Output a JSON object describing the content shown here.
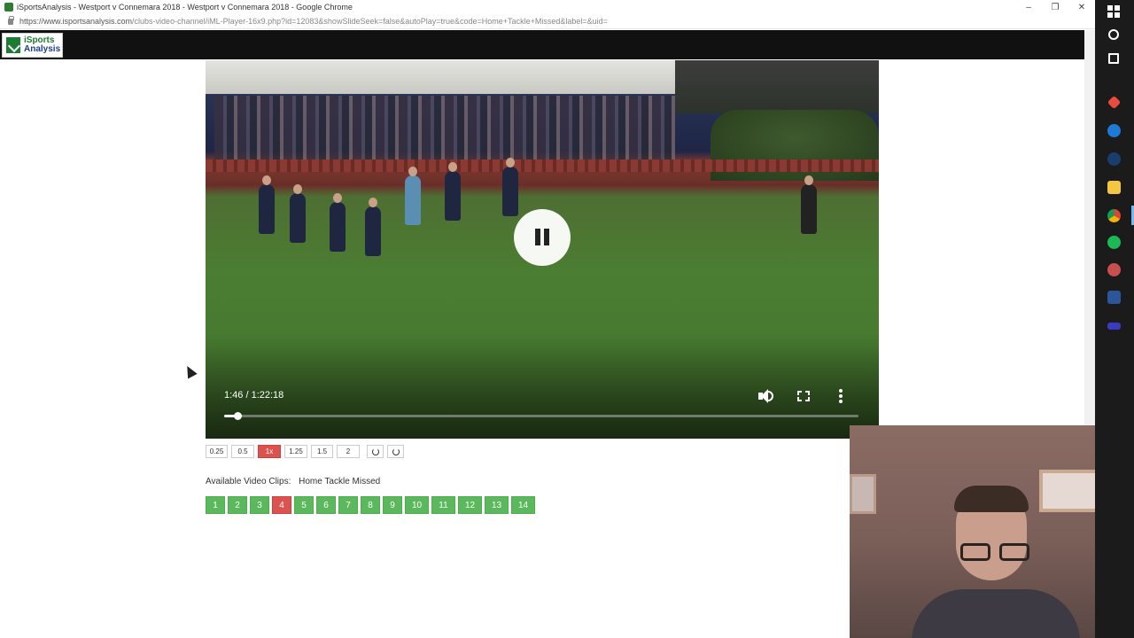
{
  "window": {
    "title": "iSportsAnalysis - Westport v Connemara 2018 - Westport v Connemara 2018 - Google Chrome",
    "minimize": "–",
    "restore": "❐",
    "close": "✕"
  },
  "address": {
    "url_host": "https://www.isportsanalysis.com",
    "url_path": "/clubs-video-channel/iML-Player-16x9.php?id=12083&showSlideSeek=false&autoPlay=true&code=Home+Tackle+Missed&label=&uid="
  },
  "logo": {
    "line1": "iSports",
    "line2": "Analysis"
  },
  "video": {
    "time": "1:46 / 1:22:18",
    "progress_fraction": 0.0215
  },
  "speeds": {
    "options": [
      "0.25",
      "0.5",
      "1x",
      "1.25",
      "1.5",
      "2"
    ],
    "active": "1x"
  },
  "clips": {
    "label": "Available Video Clips:",
    "code": "Home Tackle Missed",
    "items": [
      "1",
      "2",
      "3",
      "4",
      "5",
      "6",
      "7",
      "8",
      "9",
      "10",
      "11",
      "12",
      "13",
      "14"
    ],
    "active": "4"
  },
  "colors": {
    "active_red": "#d9534f",
    "clip_green": "#5cb85c"
  }
}
